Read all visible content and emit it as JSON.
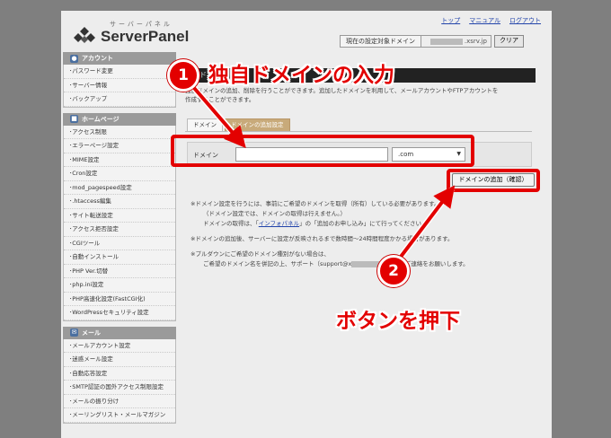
{
  "header": {
    "logo_kana": "サーバーパネル",
    "logo_name": "ServerPanel",
    "links": [
      "トップ",
      "マニュアル",
      "ログアウト"
    ],
    "target_label": "現在の設定対象ドメイン",
    "target_value": ".xsrv.jp",
    "clear_button": "クリア"
  },
  "sidebar": {
    "account": {
      "title": "アカウント",
      "items": [
        "パスワード変更",
        "サーバー情報",
        "バックアップ"
      ]
    },
    "homepage": {
      "title": "ホームページ",
      "items": [
        "アクセス制限",
        "エラーページ設定",
        "MIME設定",
        "Cron設定",
        "mod_pagespeed設定",
        ".htaccess編集",
        "サイト転送設定",
        "アクセス拒否設定",
        "CGIツール",
        "自動インストール",
        "PHP Ver.切替",
        "php.ini設定",
        "PHP高速化設定(FastCGI化)",
        "WordPressセキュリティ設定"
      ]
    },
    "mail": {
      "title": "メール",
      "items": [
        "メールアカウント設定",
        "迷惑メール設定",
        "自動応答設定",
        "SMTP認証の国外アクセス制限設定",
        "メールの振り分け",
        "メーリングリスト・メールマガジン"
      ]
    }
  },
  "main": {
    "title": "ドメイン",
    "description": [
      "独自ドメインの追加、削除を行うことができます。追加したドメインを利用して、メールアカウントやFTPアカウントを",
      "作成することができます。"
    ],
    "tabs": [
      "ドメイン",
      "ドメインの追加設定"
    ],
    "domain_label": "ドメイン",
    "domain_input_value": "",
    "tld_selected": ".com",
    "add_button": "ドメインの追加（確認）",
    "notes": {
      "n1": "※ドメイン設定を行うには、事前にご希望のドメインを取得（所有）している必要があります。",
      "n2": "（ドメイン設定では、ドメインの取得は行えません。）",
      "n3a": "ドメインの取得は、「",
      "n3link": "インフォパネル",
      "n3b": "」の「追加のお申し込み」にて行ってください。",
      "n4": "※ドメインの追加後、サーバーに設定が反映されるまで数時間～24時間程度かかる場合があります。",
      "n5": "※プルダウンにご希望のドメイン種別がない場合は、",
      "n6a": "ご希望のドメイン名を併記の上、サポート（support@x",
      "n6b": "）までご連絡をお願いします。"
    }
  },
  "annotations": {
    "step1_number": "1",
    "step1_text": "独自ドメインの入力",
    "step2_number": "2",
    "step2_text": "ボタンを押下"
  },
  "colors": {
    "highlight": "#e30000",
    "active_tab": "#c8aa7a",
    "title_bar": "#222222"
  }
}
